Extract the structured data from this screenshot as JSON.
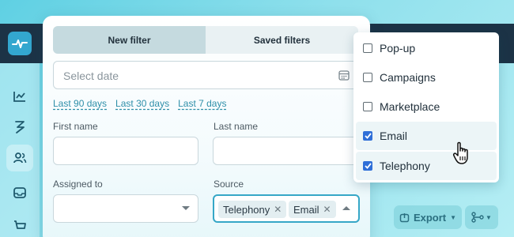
{
  "app": {
    "rail": [
      {
        "icon": "chart-line-icon"
      },
      {
        "icon": "lightning-icon"
      },
      {
        "icon": "users-icon"
      },
      {
        "icon": "inbox-icon"
      },
      {
        "icon": "cart-icon"
      }
    ],
    "export_label": "Export",
    "colors": {
      "accent": "#36a7c7",
      "sidebar_dark": "#1c3346",
      "check": "#2f6fd8"
    }
  },
  "filter": {
    "tabs": [
      {
        "label": "New filter",
        "active": true
      },
      {
        "label": "Saved filters",
        "active": false
      }
    ],
    "date": {
      "placeholder": "Select date",
      "icon": "calendar-icon"
    },
    "quick_ranges": [
      "Last 90 days",
      "Last 30 days",
      "Last 7 days"
    ],
    "first_name": {
      "label": "First name",
      "value": ""
    },
    "last_name": {
      "label": "Last name",
      "value": ""
    },
    "assigned_to": {
      "label": "Assigned to",
      "value": ""
    },
    "source": {
      "label": "Source",
      "selected": [
        "Telephony",
        "Email"
      ]
    }
  },
  "dropdown": {
    "options": [
      {
        "label": "Pop-up",
        "checked": false
      },
      {
        "label": "Campaigns",
        "checked": false
      },
      {
        "label": "Marketplace",
        "checked": false
      },
      {
        "label": "Email",
        "checked": true
      },
      {
        "label": "Telephony",
        "checked": true
      }
    ]
  }
}
